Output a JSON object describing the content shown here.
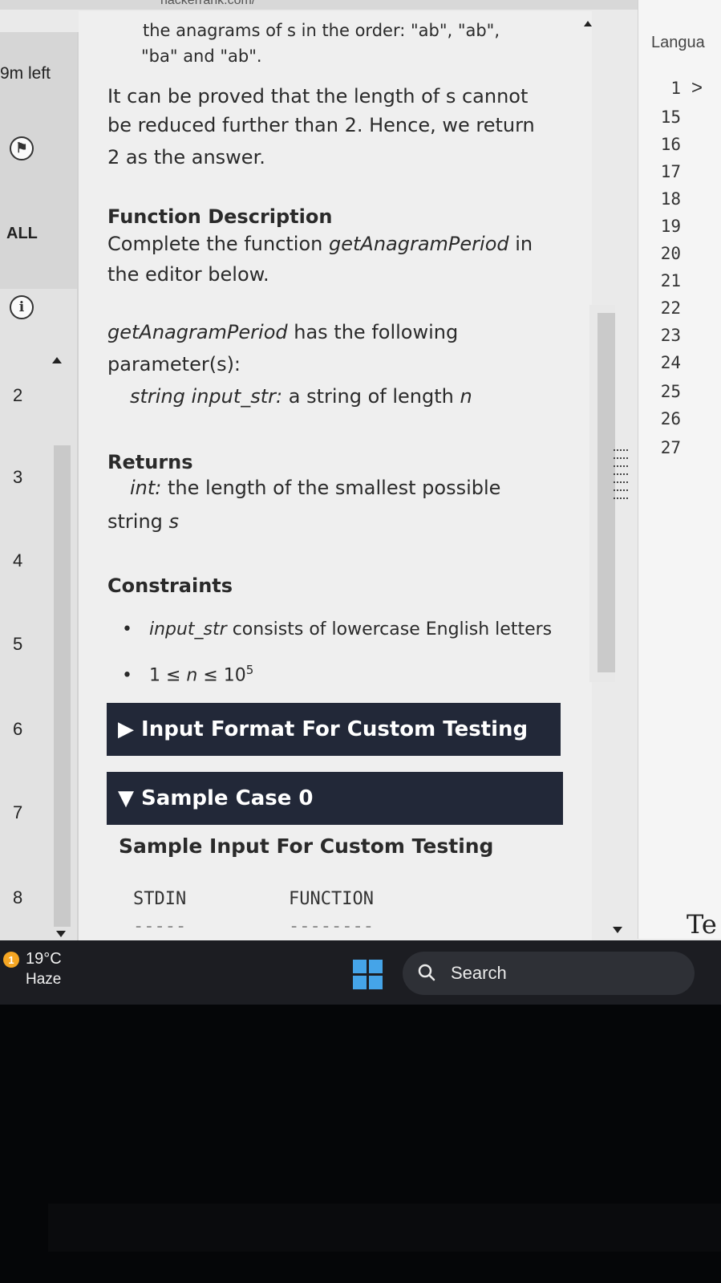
{
  "browser": {
    "url_fragment": "hackerrank.com/"
  },
  "sidebar": {
    "time_left": "9m left",
    "all_label": "ALL",
    "question_numbers": [
      "2",
      "3",
      "4",
      "5",
      "6",
      "7",
      "8"
    ]
  },
  "problem": {
    "top_line_1": "the anagrams of s in the order: \"ab\", \"ab\",",
    "top_line_2": "\"ba\" and \"ab\".",
    "proof_line_1": "It can be proved that the length of s cannot",
    "proof_line_2": "be reduced further than 2. Hence, we return",
    "proof_line_3": "2 as the answer.",
    "function_description_heading": "Function Description",
    "complete_prefix": "Complete the function ",
    "function_name": "getAnagramPeriod",
    "complete_suffix": " in",
    "editor_below": "the editor below.",
    "params_fn": "getAnagramPeriod",
    "params_suffix": " has the following",
    "params_line_2": "parameter(s):",
    "param_type": "string input_str:",
    "param_desc": " a string of length ",
    "param_n": "n",
    "returns_heading": "Returns",
    "returns_type": "int:",
    "returns_desc_1": " the length of the smallest possible",
    "returns_desc_2_prefix": "string ",
    "returns_s": "s",
    "constraints_heading": "Constraints",
    "constraint_1_code": "input_str",
    "constraint_1_rest": " consists of lowercase English letters",
    "constraint_2_prefix": "1 ≤ ",
    "constraint_2_n": "n",
    "constraint_2_mid": " ≤ 10",
    "constraint_2_exp": "5",
    "input_format_label": "Input Format For Custom Testing",
    "sample_case_label": "Sample Case 0",
    "sample_input_heading": "Sample Input For Custom Testing",
    "stdin_header": "STDIN",
    "function_header": "FUNCTION",
    "stdin_rule": "-----",
    "function_rule": "--------"
  },
  "editor": {
    "language_label": "Langua",
    "line_numbers": [
      "1",
      "15",
      "16",
      "17",
      "18",
      "19",
      "20",
      "21",
      "22",
      "23",
      "24",
      "25",
      "26",
      "27"
    ],
    "test_label": "Te"
  },
  "taskbar": {
    "weather_badge": "1",
    "temperature": "19°C",
    "condition": "Haze",
    "search_label": "Search"
  },
  "colors": {
    "section_bar_bg": "#222838",
    "windows_logo": "#45a4e8",
    "weather_badge": "#f5a623",
    "taskbar_bg": "#1c1d22"
  }
}
